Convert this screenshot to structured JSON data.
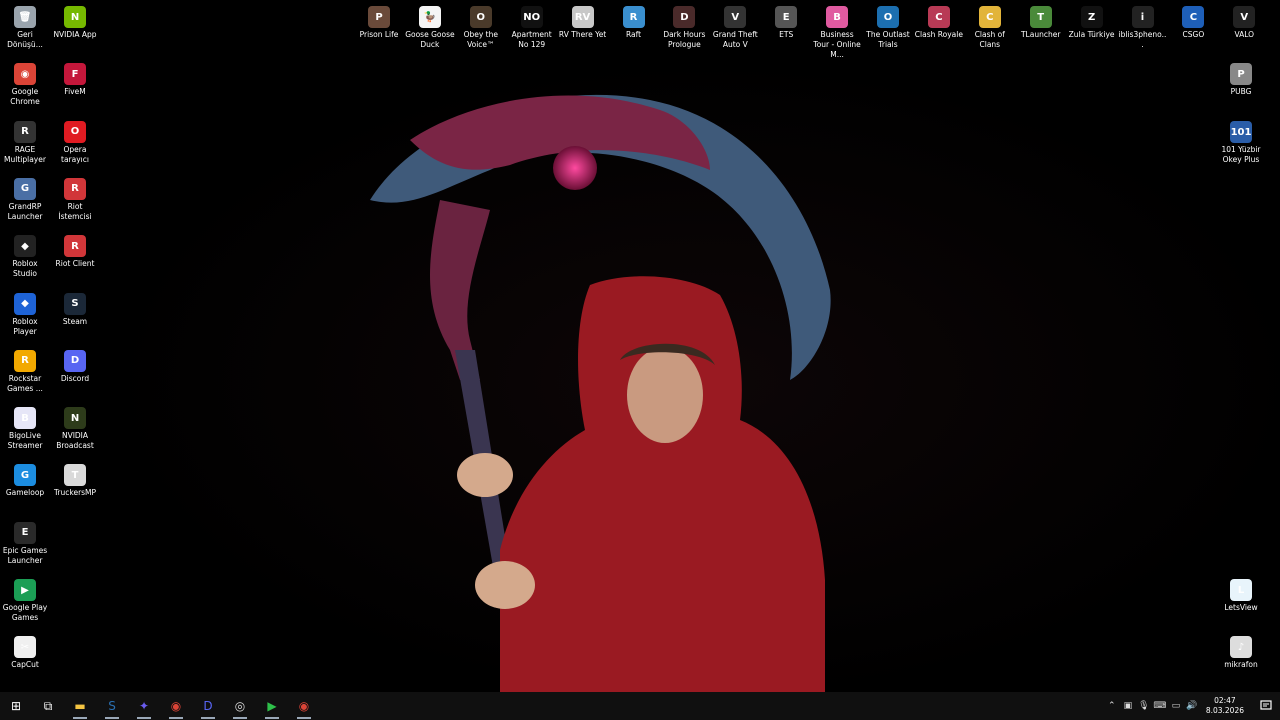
{
  "desktop": {
    "left_col1": [
      {
        "label": "Geri Dönüşü...",
        "icon": "recycle-bin-icon",
        "color": "#9aa4ad",
        "glyph": "🗑"
      },
      {
        "label": "Google Chrome",
        "icon": "chrome-icon",
        "color": "#db4437",
        "glyph": "◉"
      },
      {
        "label": "RAGE Multiplayer",
        "icon": "rage-mp-icon",
        "color": "#333",
        "glyph": "R"
      },
      {
        "label": "GrandRP Launcher",
        "icon": "grandrp-icon",
        "color": "#4a6fa5",
        "glyph": "G"
      },
      {
        "label": "Roblox Studio",
        "icon": "roblox-studio-icon",
        "color": "#222",
        "glyph": "◆"
      },
      {
        "label": "Roblox Player",
        "icon": "roblox-player-icon",
        "color": "#1e63d6",
        "glyph": "◆"
      },
      {
        "label": "Rockstar Games ...",
        "icon": "rockstar-icon",
        "color": "#f2a900",
        "glyph": "R"
      },
      {
        "label": "BigoLive Streamer",
        "icon": "bigolive-icon",
        "color": "#e6e6f7",
        "glyph": "B"
      },
      {
        "label": "Gameloop",
        "icon": "gameloop-icon",
        "color": "#1c8de0",
        "glyph": "G"
      },
      {
        "label": "Epic Games Launcher",
        "icon": "epic-games-icon",
        "color": "#2a2a2a",
        "glyph": "E"
      },
      {
        "label": "Google Play Games",
        "icon": "google-play-games-icon",
        "color": "#1b9e55",
        "glyph": "▶"
      },
      {
        "label": "CapCut",
        "icon": "capcut-icon",
        "color": "#f0f0f0",
        "glyph": "✂"
      }
    ],
    "left_col2": [
      {
        "label": "NVIDIA App",
        "icon": "nvidia-app-icon",
        "color": "#76b900",
        "glyph": "N"
      },
      {
        "label": "FiveM",
        "icon": "fivem-icon",
        "color": "#c4173b",
        "glyph": "F"
      },
      {
        "label": "Opera tarayıcı",
        "icon": "opera-icon",
        "color": "#e01b22",
        "glyph": "O"
      },
      {
        "label": "Riot İstemcisi",
        "icon": "riot-client-icon",
        "color": "#d13639",
        "glyph": "R"
      },
      {
        "label": "Riot Client",
        "icon": "riot-client-icon",
        "color": "#d13639",
        "glyph": "R"
      },
      {
        "label": "Steam",
        "icon": "steam-icon",
        "color": "#1b2838",
        "glyph": "S"
      },
      {
        "label": "Discord",
        "icon": "discord-icon",
        "color": "#5865f2",
        "glyph": "D"
      },
      {
        "label": "NVIDIA Broadcast",
        "icon": "nvidia-broadcast-icon",
        "color": "#2d3b1a",
        "glyph": "N"
      },
      {
        "label": "TruckersMP",
        "icon": "truckersmp-icon",
        "color": "#d9d9d9",
        "glyph": "T"
      }
    ],
    "top_row": [
      {
        "label": "Prison Life",
        "icon": "prison-life-icon",
        "color": "#6a4a3a",
        "glyph": "P"
      },
      {
        "label": "Goose Goose Duck",
        "icon": "goose-goose-duck-icon",
        "color": "#f5f5f5",
        "glyph": "🦆"
      },
      {
        "label": "Obey the Voice™",
        "icon": "obey-the-voice-icon",
        "color": "#4a3a2a",
        "glyph": "O"
      },
      {
        "label": "Apartment No 129",
        "icon": "apartment-129-icon",
        "color": "#111",
        "glyph": "NO"
      },
      {
        "label": "RV There Yet",
        "icon": "rv-there-yet-icon",
        "color": "#c8c8c8",
        "glyph": "RV"
      },
      {
        "label": "Raft",
        "icon": "raft-icon",
        "color": "#3a8fcf",
        "glyph": "R"
      },
      {
        "label": "Dark Hours Prologue",
        "icon": "dark-hours-icon",
        "color": "#4a2a2a",
        "glyph": "D"
      },
      {
        "label": "Grand Theft Auto V",
        "icon": "gta-v-icon",
        "color": "#333",
        "glyph": "V"
      },
      {
        "label": "ETS",
        "icon": "ets-icon",
        "color": "#555",
        "glyph": "E"
      },
      {
        "label": "Business Tour - Online M...",
        "icon": "business-tour-icon",
        "color": "#e05aa0",
        "glyph": "B"
      },
      {
        "label": "The Outlast Trials",
        "icon": "outlast-trials-icon",
        "color": "#1c6fb0",
        "glyph": "O"
      },
      {
        "label": "Clash Royale",
        "icon": "clash-royale-icon",
        "color": "#b83a55",
        "glyph": "C"
      },
      {
        "label": "Clash of Clans",
        "icon": "clash-of-clans-icon",
        "color": "#e2b43a",
        "glyph": "C"
      },
      {
        "label": "TLauncher",
        "icon": "tlauncher-icon",
        "color": "#4a8a3a",
        "glyph": "T"
      },
      {
        "label": "Zula Türkiye",
        "icon": "zula-icon",
        "color": "#111",
        "glyph": "Z"
      },
      {
        "label": "iblis3pheno...",
        "icon": "iblis-icon",
        "color": "#222",
        "glyph": "i"
      },
      {
        "label": "CSGO",
        "icon": "csgo-icon",
        "color": "#1e5fb8",
        "glyph": "C"
      },
      {
        "label": "VALO",
        "icon": "valorant-icon",
        "color": "#222",
        "glyph": "V"
      }
    ],
    "right_col": [
      {
        "label": "PUBG",
        "icon": "pubg-icon",
        "color": "#888",
        "glyph": "P"
      },
      {
        "label": "101 Yüzbir Okey Plus",
        "icon": "okey-plus-icon",
        "color": "#2a5da8",
        "glyph": "101"
      },
      {
        "label": "LetsView",
        "icon": "letsview-icon",
        "color": "#e8f4fb",
        "glyph": "L"
      },
      {
        "label": "mikrafon",
        "icon": "microphone-file-icon",
        "color": "#ddd",
        "glyph": "♪"
      }
    ]
  },
  "taskbar": {
    "items": [
      {
        "name": "start-button",
        "color": "#ffffff",
        "glyph": "⊞"
      },
      {
        "name": "task-view-button",
        "color": "#ffffff",
        "glyph": "⧉"
      },
      {
        "name": "file-explorer-icon",
        "color": "#f5c542",
        "glyph": "▬"
      },
      {
        "name": "steam-taskbar-icon",
        "color": "#2a6fb0",
        "glyph": "S"
      },
      {
        "name": "copilot-icon",
        "color": "#6a5cf0",
        "glyph": "✦"
      },
      {
        "name": "chrome-taskbar-icon",
        "color": "#db4437",
        "glyph": "◉"
      },
      {
        "name": "discord-taskbar-icon",
        "color": "#5865f2",
        "glyph": "D"
      },
      {
        "name": "obs-taskbar-icon",
        "color": "#dddddd",
        "glyph": "◎"
      },
      {
        "name": "play-taskbar-icon",
        "color": "#2ec04a",
        "glyph": "▶"
      },
      {
        "name": "chrome-taskbar-icon-2",
        "color": "#db4437",
        "glyph": "◉"
      }
    ],
    "tray": {
      "icons": [
        {
          "name": "show-hidden-icons-chevron",
          "glyph": "⌃"
        },
        {
          "name": "tray-app-icon",
          "glyph": "▣"
        },
        {
          "name": "microphone-icon",
          "glyph": "🎙"
        },
        {
          "name": "network-icon",
          "glyph": "⌨"
        },
        {
          "name": "battery-icon",
          "glyph": "▭"
        },
        {
          "name": "volume-icon",
          "glyph": "🔊"
        }
      ],
      "time": "02:47",
      "date": "8.03.2026"
    }
  }
}
